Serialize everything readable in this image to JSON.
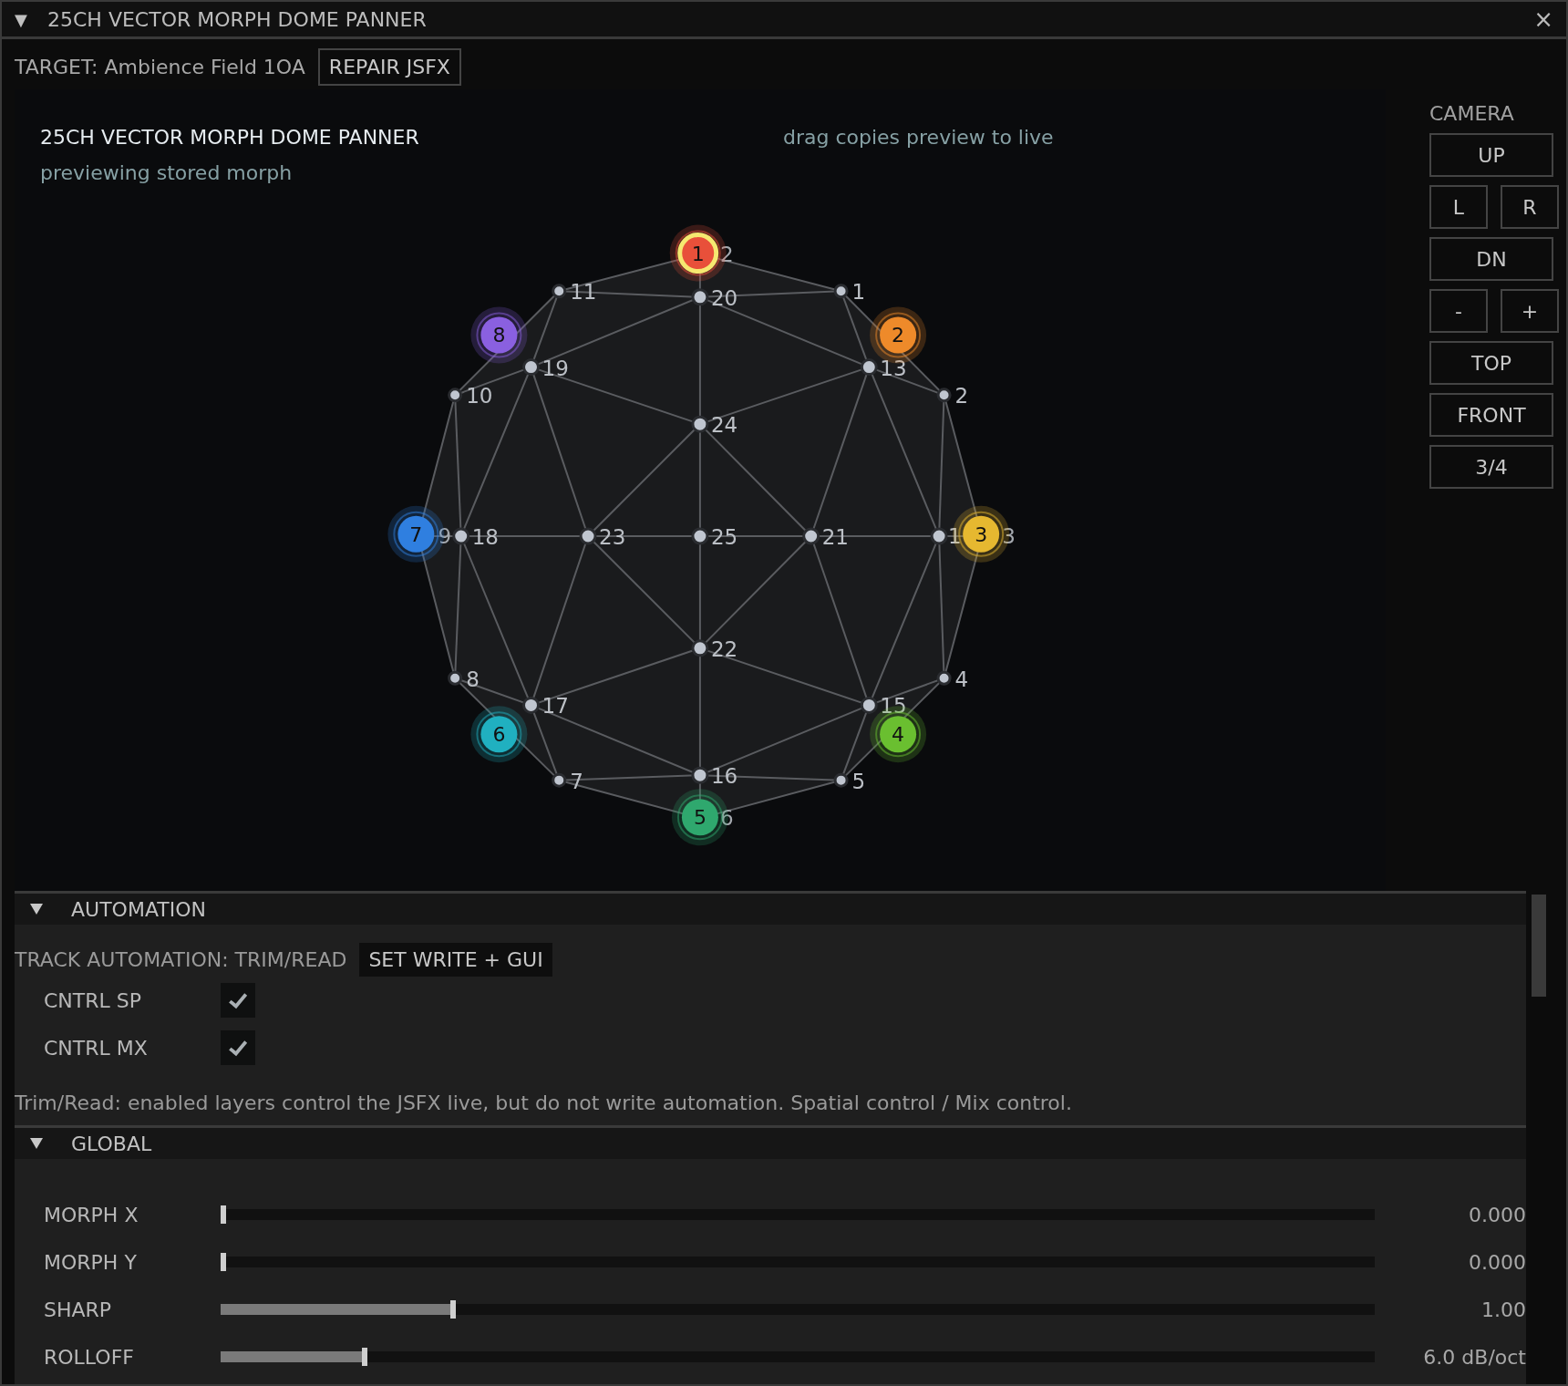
{
  "window": {
    "title": "25CH VECTOR MORPH DOME PANNER",
    "collapse_icon": "▼",
    "close": "×"
  },
  "target": {
    "label": "TARGET: Ambience Field 1OA",
    "button": "REPAIR JSFX"
  },
  "view": {
    "title": "25CH VECTOR MORPH DOME PANNER",
    "status": "previewing stored morph",
    "hint": "drag copies preview to live",
    "nodes": [
      {
        "label": "1",
        "covered": false
      },
      {
        "label": "2",
        "covered": false
      },
      {
        "label": "3",
        "covered": true
      },
      {
        "label": "4",
        "covered": false
      },
      {
        "label": "5",
        "covered": false
      },
      {
        "label": "6",
        "covered": true
      },
      {
        "label": "7",
        "covered": false
      },
      {
        "label": "8",
        "covered": false
      },
      {
        "label": "9",
        "covered": true
      },
      {
        "label": "10",
        "covered": false
      },
      {
        "label": "11",
        "covered": false
      },
      {
        "label": "2",
        "covered": true
      },
      {
        "label": "13",
        "covered": false
      },
      {
        "label": "1",
        "covered": false
      },
      {
        "label": "15",
        "covered": false
      },
      {
        "label": "16",
        "covered": false
      },
      {
        "label": "17",
        "covered": false
      },
      {
        "label": "18",
        "covered": false
      },
      {
        "label": "19",
        "covered": false
      },
      {
        "label": "20",
        "covered": false
      },
      {
        "label": "21",
        "covered": false
      },
      {
        "label": "22",
        "covered": false
      },
      {
        "label": "23",
        "covered": false
      },
      {
        "label": "24",
        "covered": false
      },
      {
        "label": "25",
        "covered": false
      }
    ],
    "speakers": [
      {
        "label": "1",
        "color": "#e8503a",
        "selected": true
      },
      {
        "label": "2",
        "color": "#ee8a2a",
        "selected": false
      },
      {
        "label": "3",
        "color": "#e6b830",
        "selected": false
      },
      {
        "label": "4",
        "color": "#6abf30",
        "selected": false
      },
      {
        "label": "5",
        "color": "#2fa86e",
        "selected": false
      },
      {
        "label": "6",
        "color": "#20b0c0",
        "selected": false
      },
      {
        "label": "7",
        "color": "#2f7fe0",
        "selected": false
      },
      {
        "label": "8",
        "color": "#8a60e0",
        "selected": false
      }
    ]
  },
  "camera": {
    "title": "CAMERA",
    "buttons": [
      [
        "UP"
      ],
      [
        "L",
        "R"
      ],
      [
        "DN"
      ],
      [
        "-",
        "+"
      ],
      [
        "TOP"
      ],
      [
        "FRONT"
      ],
      [
        "3/4"
      ]
    ]
  },
  "automation": {
    "title": "AUTOMATION",
    "expanded": true,
    "mode": "TRACK AUTOMATION: TRIM/READ",
    "button": "SET WRITE + GUI",
    "options": [
      {
        "label": "CNTRL SP",
        "checked": true
      },
      {
        "label": "CNTRL MX",
        "checked": true
      }
    ],
    "note": "Trim/Read: enabled layers control the JSFX live, but do not write automation. Spatial control / Mix control."
  },
  "global": {
    "title": "GLOBAL",
    "expanded": true,
    "sliders": [
      {
        "label": "MORPH X",
        "level": 0.0,
        "reading": "0.000"
      },
      {
        "label": "MORPH Y",
        "level": 0.0,
        "reading": "0.000"
      },
      {
        "label": "SHARP",
        "level": 0.2,
        "reading": "1.00"
      },
      {
        "label": "ROLLOFF",
        "level": 0.123,
        "reading": "6.0 dB/oct"
      }
    ]
  }
}
